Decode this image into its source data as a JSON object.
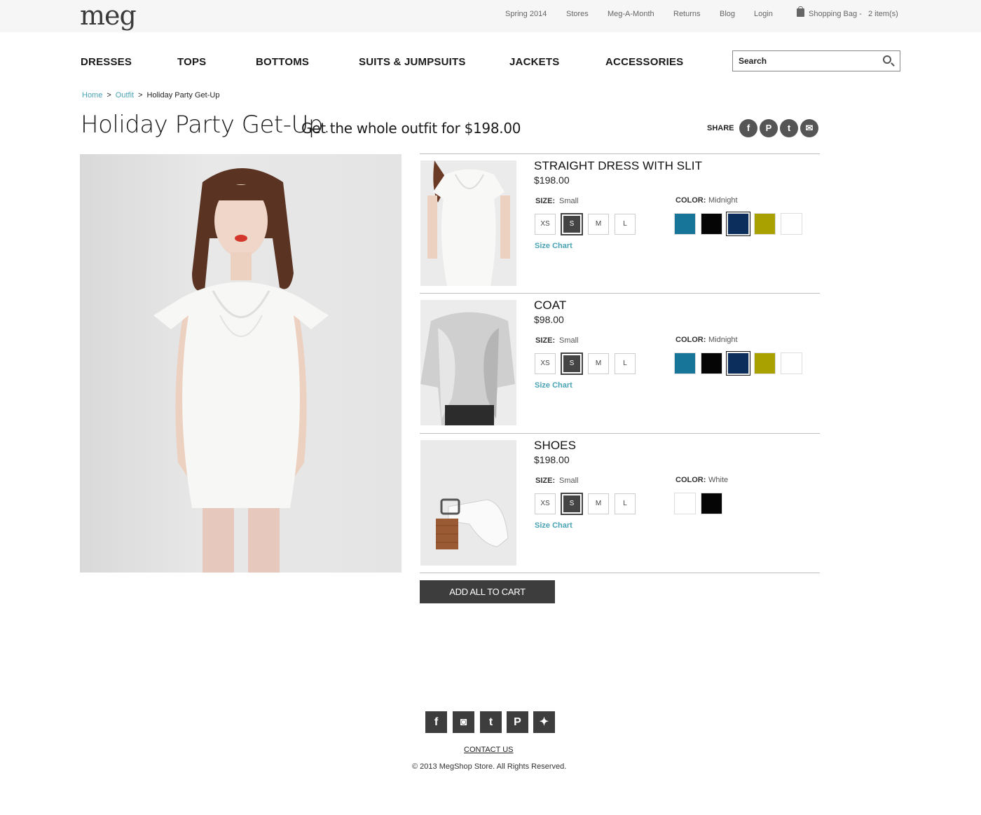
{
  "brand": {
    "logo_text": "meg"
  },
  "toplinks": {
    "spring": "Spring 2014",
    "stores": "Stores",
    "meg_a_month": "Meg-A-Month",
    "returns": "Returns",
    "blog": "Blog",
    "login": "Login",
    "bag": "Shopping Bag -",
    "bag_count": "2 item(s)"
  },
  "nav": {
    "dresses": "DRESSES",
    "tops": "TOPS",
    "bottoms": "BOTTOMS",
    "suits": "SUITS & JUMPSUITS",
    "jackets": "JACKETS",
    "accessories": "ACCESSORIES"
  },
  "search": {
    "placeholder": "Search"
  },
  "breadcrumb": {
    "home": "Home",
    "sep": ">",
    "outfit": "Outfit",
    "current": "Holiday Party Get-Up"
  },
  "page": {
    "title": "Holiday Party Get-Up.",
    "subtitle": "Get the whole outfit for $198.00"
  },
  "share": {
    "label": "SHARE",
    "facebook": "f",
    "pinterest": "P",
    "twitter": "t",
    "email": "✉"
  },
  "sizes": [
    "XS",
    "S",
    "M",
    "L"
  ],
  "size_chart_label": "Size Chart",
  "size_label": "SIZE:",
  "color_label": "COLOR:",
  "products": [
    {
      "name": "STRAIGHT DRESS WITH SLIT",
      "price": "$198.00",
      "size": "Small",
      "color": "Midnight",
      "selected_size": "S",
      "swatches": [
        "#17759a",
        "#050505",
        "#0c2e5c",
        "#a9a100",
        "#ffffff"
      ],
      "selected_swatch": 2
    },
    {
      "name": "COAT",
      "price": "$98.00",
      "size": "Small",
      "color": "Midnight",
      "selected_size": "S",
      "swatches": [
        "#17759a",
        "#050505",
        "#0c2e5c",
        "#a9a100",
        "#ffffff"
      ],
      "selected_swatch": 2
    },
    {
      "name": "SHOES",
      "price": "$198.00",
      "size": "Small",
      "color": "White",
      "selected_size": "S",
      "swatches": [
        "#ffffff",
        "#050505"
      ],
      "selected_swatch": -1
    }
  ],
  "cart": {
    "add_all": "ADD ALL TO CART"
  },
  "footer": {
    "social": {
      "facebook": "f",
      "instagram": "◙",
      "tumblr": "t",
      "pinterest": "P",
      "twitter": "✦"
    },
    "contact": "CONTACT US",
    "copyright": "© 2013 MegShop Store.  All Rights Reserved."
  },
  "colors": {
    "link": "#4aa3b5",
    "button": "#3d3d3d",
    "topbar": "#f6f6f6"
  }
}
